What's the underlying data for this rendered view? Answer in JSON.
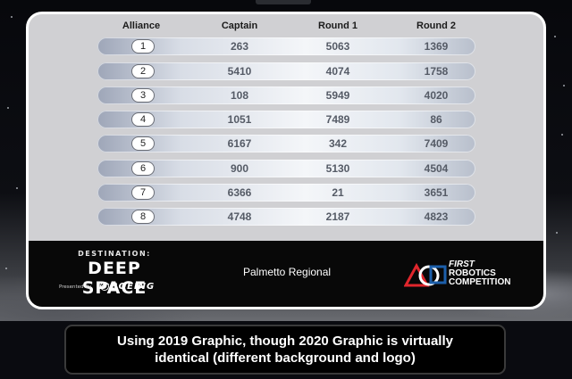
{
  "headers": {
    "alliance": "Alliance",
    "captain": "Captain",
    "round1": "Round 1",
    "round2": "Round 2"
  },
  "rows": [
    {
      "alliance": "1",
      "captain": "263",
      "round1": "5063",
      "round2": "1369"
    },
    {
      "alliance": "2",
      "captain": "5410",
      "round1": "4074",
      "round2": "1758"
    },
    {
      "alliance": "3",
      "captain": "108",
      "round1": "5949",
      "round2": "4020"
    },
    {
      "alliance": "4",
      "captain": "1051",
      "round1": "7489",
      "round2": "86"
    },
    {
      "alliance": "5",
      "captain": "6167",
      "round1": "342",
      "round2": "7409"
    },
    {
      "alliance": "6",
      "captain": "900",
      "round1": "5130",
      "round2": "4504"
    },
    {
      "alliance": "7",
      "captain": "6366",
      "round1": "21",
      "round2": "3651"
    },
    {
      "alliance": "8",
      "captain": "4748",
      "round1": "2187",
      "round2": "4823"
    }
  ],
  "footer": {
    "destination": "DESTINATION:",
    "deep_space": "DEEP SPACE",
    "presented_by": "Presented By",
    "sponsor": "BOEING",
    "event_name": "Palmetto Regional",
    "first_line1": "FIRST",
    "first_line2": "ROBOTICS",
    "first_line3": "COMPETITION"
  },
  "caption": {
    "line1": "Using 2019 Graphic, though 2020 Graphic is virtually",
    "line2": "identical (different background and logo)"
  },
  "colors": {
    "first_red": "#e0262c",
    "first_blue": "#1c5fab",
    "panel_grey": "#d0d0d3",
    "number_text": "#555b66"
  },
  "icons": {
    "sponsor_logo": "boeing-logo-icon",
    "first_logo": "first-logo-icon"
  }
}
